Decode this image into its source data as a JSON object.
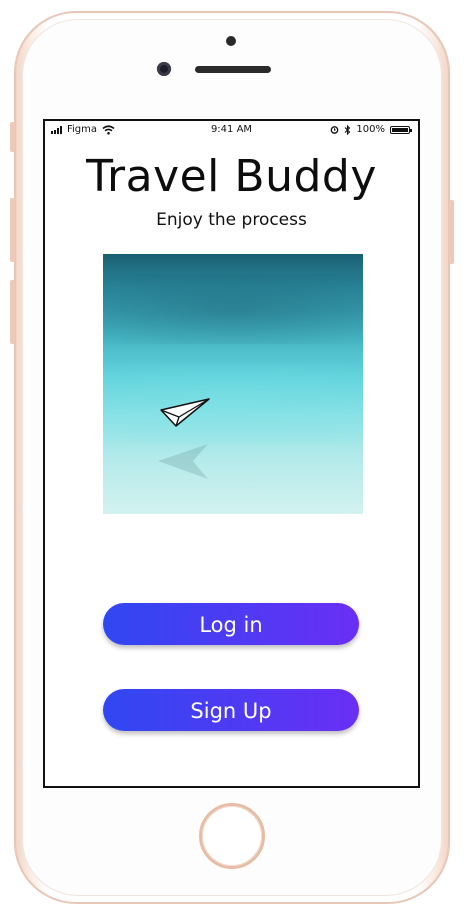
{
  "status_bar": {
    "carrier": "Figma",
    "time": "9:41 AM",
    "battery_percent": "100%"
  },
  "app": {
    "title": "Travel Buddy",
    "subtitle": "Enjoy the process"
  },
  "hero_image": {
    "icon": "paper-plane-icon",
    "colors": [
      "#1a5f72",
      "#46b6c4",
      "#8ae0e4",
      "#d3f2f0"
    ]
  },
  "actions": {
    "login_label": "Log in",
    "signup_label": "Sign Up",
    "button_gradient": [
      "#3047f2",
      "#6a2ff4"
    ]
  }
}
